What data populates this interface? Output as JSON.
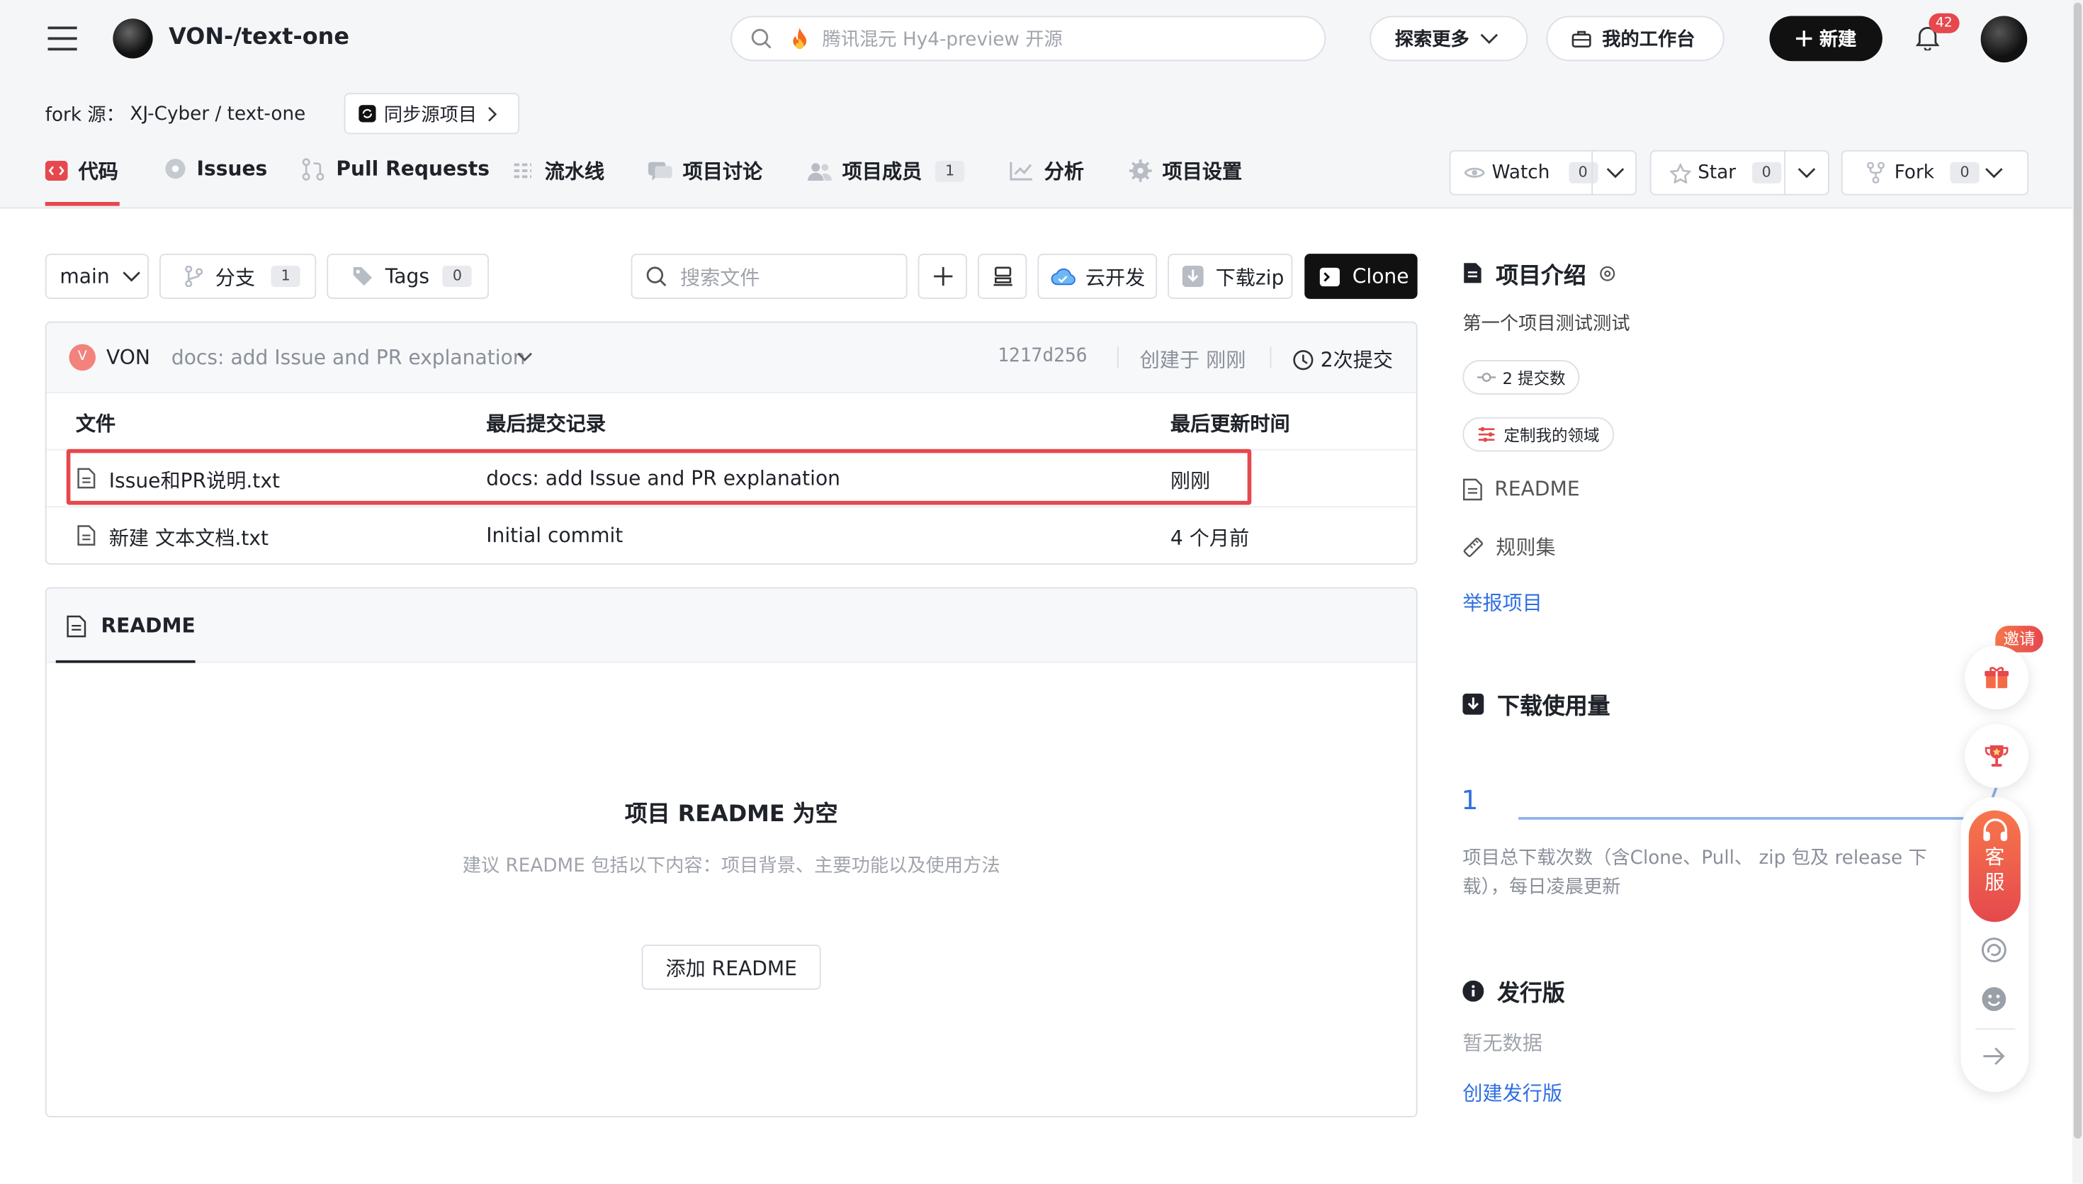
{
  "header": {
    "repo_path": "VON-/text-one",
    "search_placeholder": "腾讯混元 Hy4-preview 开源",
    "explore_label": "探索更多",
    "workbench_label": "我的工作台",
    "new_label": "新建",
    "notification_count": "42"
  },
  "fork": {
    "label": "fork 源：",
    "source": "XJ-Cyber / text-one",
    "sync_label": "同步源项目"
  },
  "tabs": [
    {
      "label": "代码",
      "active": true
    },
    {
      "label": "Issues"
    },
    {
      "label": "Pull Requests"
    },
    {
      "label": "流水线"
    },
    {
      "label": "项目讨论"
    },
    {
      "label": "项目成员",
      "count": "1"
    },
    {
      "label": "分析"
    },
    {
      "label": "项目设置"
    }
  ],
  "social": {
    "watch_label": "Watch",
    "watch_count": "0",
    "star_label": "Star",
    "star_count": "0",
    "fork_label": "Fork",
    "fork_count": "0"
  },
  "toolbar": {
    "branch": "main",
    "branches_label": "分支",
    "branches_count": "1",
    "tags_label": "Tags",
    "tags_count": "0",
    "file_search_placeholder": "搜索文件",
    "cloud_dev_label": "云开发",
    "download_zip_label": "下载zip",
    "clone_label": "Clone"
  },
  "commit": {
    "avatar_letter": "V",
    "author": "VON",
    "message": "docs: add Issue and PR explanation",
    "hash": "1217d256",
    "created": "创建于 刚刚",
    "commit_count": "2次提交"
  },
  "files": {
    "headers": {
      "name": "文件",
      "last_commit": "最后提交记录",
      "updated": "最后更新时间"
    },
    "rows": [
      {
        "name": "Issue和PR说明.txt",
        "commit": "docs: add Issue and PR explanation",
        "time": "刚刚",
        "highlighted": true
      },
      {
        "name": "新建 文本文档.txt",
        "commit": "Initial commit",
        "time": "4 个月前"
      }
    ]
  },
  "readme": {
    "tab_label": "README",
    "empty_title": "项目 README 为空",
    "empty_hint": "建议 README 包括以下内容：项目背景、主要功能以及使用方法",
    "add_button": "添加 README"
  },
  "sidebar": {
    "intro_title": "项目介绍",
    "description": "第一个项目测试测试",
    "commits_chip": "2 提交数",
    "domain_chip": "定制我的领域",
    "readme_link": "README",
    "rules_link": "规则集",
    "report_link": "举报项目",
    "downloads_title": "下载使用量",
    "downloads_value": "1",
    "downloads_note": "项目总下载次数（含Clone、Pull、 zip 包及 release 下载），每日凌晨更新",
    "releases_title": "发行版",
    "releases_empty": "暂无数据",
    "create_release": "创建发行版"
  },
  "floating": {
    "invite_label": "邀请",
    "service_label_1": "客",
    "service_label_2": "服"
  },
  "colors": {
    "accent_red": "#e5484d",
    "link_blue": "#2f6fe0",
    "black_button": "#111111",
    "highlight_box": "#e5484d"
  }
}
